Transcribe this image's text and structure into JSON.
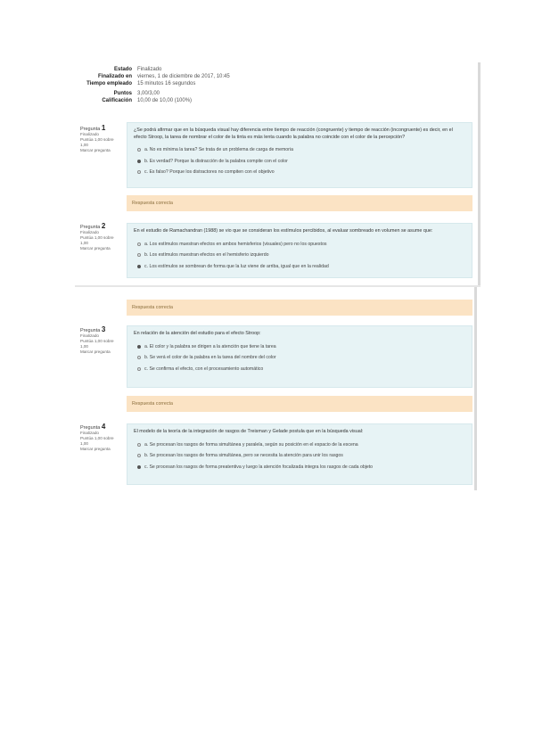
{
  "summary": [
    {
      "label": "Estado",
      "value": "Finalizado"
    },
    {
      "label": "Finalizado en",
      "value": "viernes, 1 de diciembre de 2017, 10:45"
    },
    {
      "label": "Tiempo empleado",
      "value": "15 minutos 16 segundos"
    },
    {
      "label": "Puntos",
      "value": "3,00/3,00"
    },
    {
      "label": "Calificación",
      "value": "10,00 de 10,00 (100%)"
    }
  ],
  "questions": [
    {
      "label": "Pregunta",
      "number": "1",
      "status": "Finalizado",
      "score": "Puntúa 1,00 sobre 1,00",
      "flag": "Marcar pregunta",
      "text": "¿Se podrá afirmar que en la búsqueda visual hay diferencia entre tiempo de reacción (congruente) y tiempo de reacción (incongruente) es decir, en el efecto Stroop, la tarea de nombrar el color de la tinta es más lenta cuando la palabra no coincide con el color de la percepción?",
      "options": [
        {
          "text": "a. No es mínima la tarea? Se trata de un problema de carga de memoria",
          "selected": false
        },
        {
          "text": "b. Es verdad? Porque la distracción de la palabra compite con el color",
          "selected": true
        },
        {
          "text": "c. Es falso? Porque los distractores no compiten con el objetivo",
          "selected": false
        }
      ],
      "feedback": "Respuesta correcta"
    },
    {
      "label": "Pregunta",
      "number": "2",
      "status": "Finalizado",
      "score": "Puntúa 1,00 sobre 1,00",
      "flag": "Marcar pregunta",
      "text": "En el estudio de Ramachandran (1988) se vio que se consideran los estímulos percibidos, al evaluar sombreado en volumen se asume que:",
      "options": [
        {
          "text": "a. Los estímulos muestran efectos en ambos hemisferios (visuales) pero no los opuestos",
          "selected": false
        },
        {
          "text": "b. Los estímulos muestran efectos en el hemisferio izquierdo",
          "selected": false
        },
        {
          "text": "c. Los estímulos se sombrean de forma que la luz viene de arriba, igual que en la realidad",
          "selected": true
        }
      ],
      "feedback": "Respuesta correcta"
    },
    {
      "label": "Pregunta",
      "number": "3",
      "status": "Finalizado",
      "score": "Puntúa 1,00 sobre 1,00",
      "flag": "Marcar pregunta",
      "text": "En relación de la atención del estudio para el efecto Stroop:",
      "options": [
        {
          "text": "a. El color y la palabra se dirigen a la atención que tiene la tarea",
          "selected": true
        },
        {
          "text": "b. Se verá el color de la palabra en la tarea del nombre del color",
          "selected": false
        },
        {
          "text": "c. Se confirma el efecto, con el procesamiento automático",
          "selected": false
        }
      ],
      "feedback": "Respuesta correcta"
    },
    {
      "label": "Pregunta",
      "number": "4",
      "status": "Finalizado",
      "score": "Puntúa 1,00 sobre 1,00",
      "flag": "Marcar pregunta",
      "text": "El modelo de la teoría de la integración de rasgos de Treisman y Gelade postula que en la búsqueda visual:",
      "options": [
        {
          "text": "a. Se procesan los rasgos de forma simultánea y paralela, según su posición en el espacio de la escena",
          "selected": false
        },
        {
          "text": "b. Se procesan los rasgos de forma simultánea, pero se necesita la atención para unir los rasgos",
          "selected": false
        },
        {
          "text": "c. Se procesan los rasgos de forma preatentiva y luego la atención focalizada integra los rasgos de cada objeto",
          "selected": true
        }
      ],
      "feedback": ""
    }
  ],
  "icons": {
    "selected": "radio-selected-icon",
    "unselected": "radio-icon"
  }
}
